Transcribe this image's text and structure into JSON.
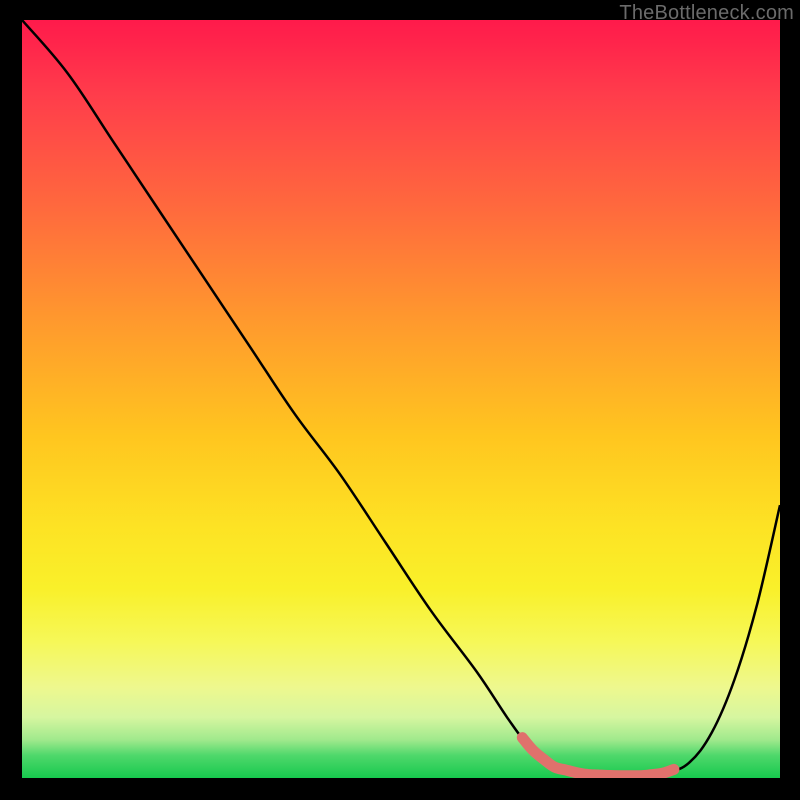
{
  "watermark": "TheBottleneck.com",
  "colors": {
    "frame": "#000000",
    "curve": "#000000",
    "accent": "#e0716c",
    "gradient_top": "#ff1a4b",
    "gradient_bottom": "#17c94e"
  },
  "chart_data": {
    "type": "line",
    "title": "",
    "xlabel": "",
    "ylabel": "",
    "xlim": [
      0,
      100
    ],
    "ylim": [
      0,
      100
    ],
    "grid": false,
    "legend": false,
    "series": [
      {
        "name": "curve",
        "x": [
          0,
          6,
          12,
          18,
          24,
          30,
          36,
          42,
          48,
          54,
          60,
          64,
          67,
          70,
          74,
          78,
          82,
          85,
          88,
          91,
          94,
          97,
          100
        ],
        "values": [
          100,
          93,
          84,
          75,
          66,
          57,
          48,
          40,
          31,
          22,
          14,
          8,
          4,
          1.5,
          0.5,
          0.3,
          0.3,
          0.7,
          2,
          6,
          13,
          23,
          36
        ]
      }
    ],
    "accent_segment": {
      "x_start": 66,
      "x_end": 86
    }
  }
}
